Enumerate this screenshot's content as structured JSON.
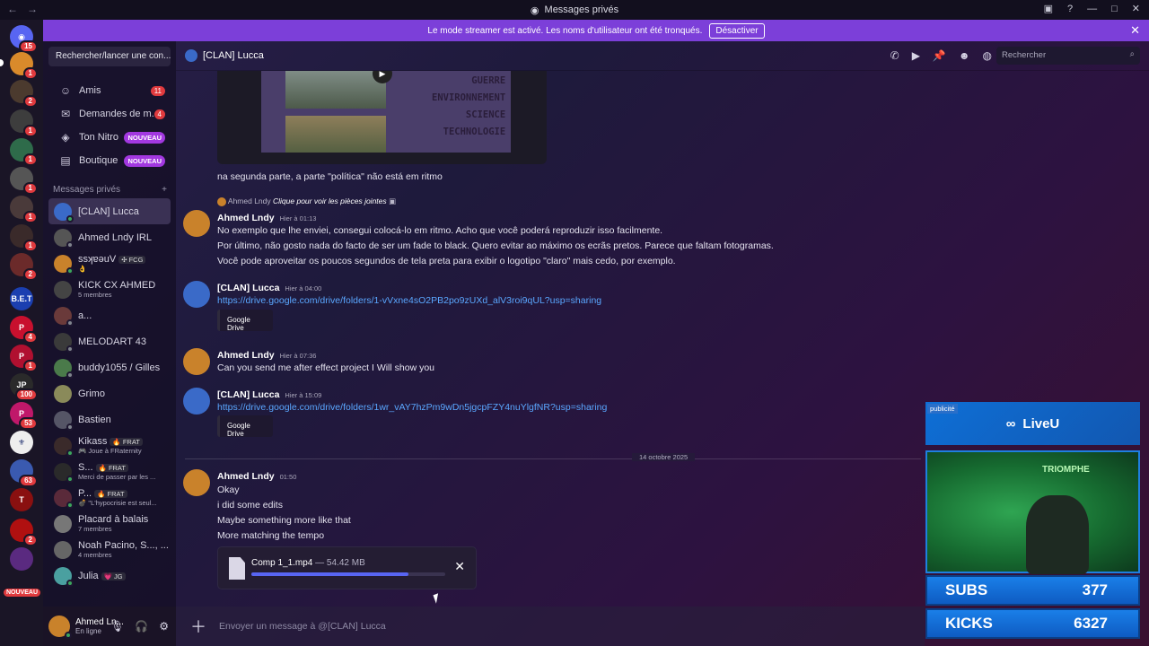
{
  "titlebar": {
    "title": "Messages privés"
  },
  "banner": {
    "text": "Le mode streamer est activé. Les noms d'utilisateur ont été tronqués.",
    "button": "Désactiver"
  },
  "servers": {
    "badges": [
      "15",
      "1",
      "2",
      "1",
      "1",
      "1",
      "1",
      "1",
      "2",
      "1",
      "4",
      "1",
      "100",
      "53",
      "63",
      "2"
    ],
    "new_label": "NOUVEAU"
  },
  "dm_sidebar": {
    "search_placeholder": "Rechercher/lancer une con...",
    "nav": [
      {
        "label": "Amis",
        "badge": "11"
      },
      {
        "label": "Demandes de m...",
        "badge": "4"
      },
      {
        "label": "Ton Nitro",
        "badge": "NOUVEAU"
      },
      {
        "label": "Boutique",
        "badge": "NOUVEAU"
      }
    ],
    "section_title": "Messages privés",
    "items": [
      {
        "name": "[CLAN] Lucca",
        "sub": ""
      },
      {
        "name": "Ahmed Lndy IRL",
        "sub": ""
      },
      {
        "name": "ssʞɐǝuV",
        "tag": "✣ FCG",
        "sub": "👌"
      },
      {
        "name": "KICK CX AHMED",
        "sub": "5 membres"
      },
      {
        "name": "a...",
        "sub": ""
      },
      {
        "name": "MELODART 43",
        "sub": ""
      },
      {
        "name": "buddy1055 / Gilles",
        "sub": ""
      },
      {
        "name": "Grimo",
        "sub": ""
      },
      {
        "name": "Bastien",
        "sub": ""
      },
      {
        "name": "Kikass",
        "tag": "🔥 FRAT",
        "sub": "🎮 Joue à FRaternity"
      },
      {
        "name": "S...",
        "tag": "🔥 FRAT",
        "sub": "Merci de passer par les ..."
      },
      {
        "name": "P...",
        "tag": "🔥 FRAT",
        "sub": "💣 \"L'hypocrisie est seul..."
      },
      {
        "name": "Placard à balais",
        "sub": "7 membres"
      },
      {
        "name": "Noah Pacino, S..., ...",
        "sub": "4 membres"
      },
      {
        "name": "Julia",
        "tag": "💗 JG",
        "sub": ""
      }
    ]
  },
  "user": {
    "name": "Ahmed Ln...",
    "status": "En ligne"
  },
  "channel": {
    "name": "[CLAN] Lucca",
    "search": "Rechercher"
  },
  "thumbnail_words": [
    "GUERRE",
    "ENVIRONNEMENT",
    "SCIENCE",
    "TECHNOLOGIE"
  ],
  "messages": {
    "m0": {
      "text": "na segunda parte, a parte \"política\" não está em ritmo"
    },
    "reply": {
      "author": "Ahmed Lndy",
      "hint": "Clique pour voir les pièces jointes"
    },
    "m1": {
      "author": "Ahmed Lndy",
      "time": "Hier à 01:13",
      "lines": [
        "No exemplo que lhe enviei, consegui colocá-lo em ritmo. Acho que você poderá reproduzir isso facilmente.",
        "Por último, não gosto nada do facto de ser um fade to black. Quero evitar ao máximo os ecrãs pretos. Parece que faltam fotogramas.",
        "Você pode aproveitar os poucos segundos de tela preta para exibir o logotipo \"claro\" mais cedo, por exemplo."
      ]
    },
    "m2": {
      "author": "[CLAN] Lucca",
      "time": "Hier à 04:00",
      "link": "https://drive.google.com/drive/folders/1-vVxne4sO2PB2po9zUXd_alV3roi9qUL?usp=sharing",
      "embed": "Google Drive"
    },
    "m3": {
      "author": "Ahmed Lndy",
      "time": "Hier à 07:36",
      "text": "Can you send me after effect project I Will show you"
    },
    "m4": {
      "author": "[CLAN] Lucca",
      "time": "Hier à 15:09",
      "link": "https://drive.google.com/drive/folders/1wr_vAY7hzPm9wDn5jgcpFZY4nuYlgfNR?usp=sharing",
      "embed": "Google Drive"
    },
    "date_divider": "14 octobre 2025",
    "m5": {
      "author": "Ahmed Lndy",
      "time": "01:50",
      "lines": [
        "Okay",
        "i did some edits",
        "Maybe something more like that",
        "More matching the tempo"
      ]
    }
  },
  "upload": {
    "filename": "Comp 1_1.mp4",
    "size": "— 54.42 MB",
    "progress": 0.81
  },
  "composer": {
    "placeholder": "Envoyer un message à @[CLAN] Lucca"
  },
  "overlay": {
    "ad_label": "publicité",
    "brand": "LiveU",
    "cam_text": "TRIOMPHE",
    "subs_label": "SUBS",
    "subs_value": "377",
    "kicks_label": "KICKS",
    "kicks_value": "6327"
  }
}
